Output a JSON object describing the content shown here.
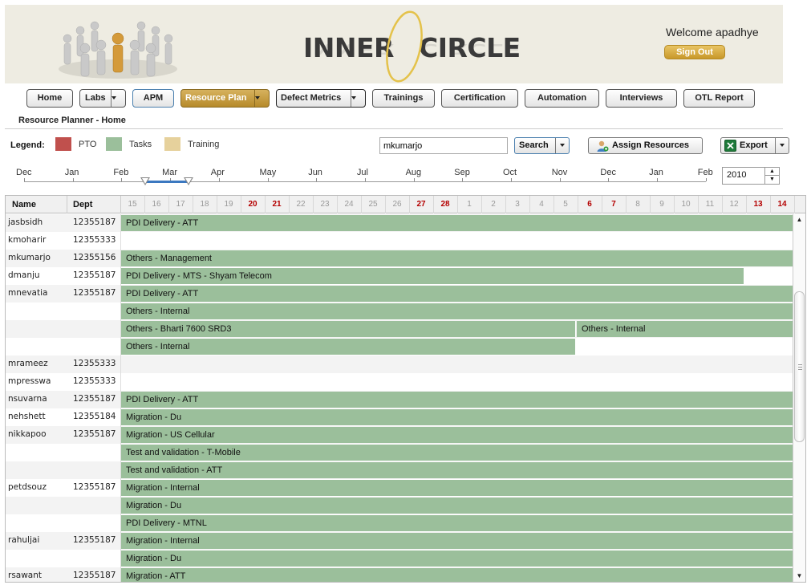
{
  "header": {
    "brand_left": "INNER",
    "brand_right": "CIRCLE",
    "welcome": "Welcome apadhye",
    "signout_label": "Sign Out"
  },
  "nav": [
    {
      "label": "Home"
    },
    {
      "label": "Labs"
    },
    {
      "label": "APM"
    },
    {
      "label": "Resource Plan",
      "active": true
    },
    {
      "label": "Defect Metrics"
    },
    {
      "label": "Trainings"
    },
    {
      "label": "Certification"
    },
    {
      "label": "Automation"
    },
    {
      "label": "Interviews"
    },
    {
      "label": "OTL Report"
    }
  ],
  "breadcrumb": "Resource Planner - Home",
  "legend": {
    "label": "Legend:",
    "items": [
      {
        "label": "PTO",
        "color": "#c0504d"
      },
      {
        "label": "Tasks",
        "color": "#9bbf9b"
      },
      {
        "label": "Training",
        "color": "#e6d19c"
      }
    ]
  },
  "search": {
    "value": "mkumarjo",
    "button_label": "Search"
  },
  "assign_label": "Assign Resources",
  "export_label": "Export",
  "months": [
    "Dec",
    "Jan",
    "Feb",
    "Mar",
    "Apr",
    "May",
    "Jun",
    "Jul",
    "Aug",
    "Sep",
    "Oct",
    "Nov",
    "Dec",
    "Jan",
    "Feb"
  ],
  "year": "2010",
  "grid": {
    "col_name": "Name",
    "col_dept": "Dept",
    "days": [
      "15",
      "16",
      "17",
      "18",
      "19",
      "20",
      "21",
      "22",
      "23",
      "24",
      "25",
      "26",
      "27",
      "28",
      "1",
      "2",
      "3",
      "4",
      "5",
      "6",
      "7",
      "8",
      "9",
      "10",
      "11",
      "12",
      "13",
      "14"
    ],
    "weekend_days": [
      "20",
      "21",
      "27",
      "28",
      "6",
      "7",
      "13",
      "14"
    ],
    "rows": [
      {
        "name": "jasbsidh",
        "dept": "12355187",
        "task": "PDI Delivery - ATT"
      },
      {
        "name": "kmoharir",
        "dept": "12355333",
        "task": ""
      },
      {
        "name": "mkumarjo",
        "dept": "12355156",
        "task": "Others - Management"
      },
      {
        "name": "dmanju",
        "dept": "12355187",
        "task": "PDI Delivery - MTS - Shyam Telecom"
      },
      {
        "name": "mnevatia",
        "dept": "12355187",
        "task": "PDI Delivery - ATT"
      },
      {
        "name": "",
        "dept": "",
        "task": "Others - Internal"
      },
      {
        "name": "",
        "dept": "",
        "task": "Others - Bharti 7600 SRD3",
        "task2": "Others - Internal"
      },
      {
        "name": "",
        "dept": "",
        "task": "Others - Internal"
      },
      {
        "name": "mrameez",
        "dept": "12355333",
        "task": ""
      },
      {
        "name": "mpresswa",
        "dept": "12355333",
        "task": ""
      },
      {
        "name": "nsuvarna",
        "dept": "12355187",
        "task": "PDI Delivery - ATT"
      },
      {
        "name": "nehshett",
        "dept": "12355184",
        "task": "Migration - Du"
      },
      {
        "name": "nikkapoo",
        "dept": "12355187",
        "task": "Migration - US Cellular"
      },
      {
        "name": "",
        "dept": "",
        "task": "Test and validation - T-Mobile"
      },
      {
        "name": "",
        "dept": "",
        "task": "Test and validation - ATT"
      },
      {
        "name": "petdsouz",
        "dept": "12355187",
        "task": "Migration - Internal"
      },
      {
        "name": "",
        "dept": "",
        "task": "Migration - Du"
      },
      {
        "name": "",
        "dept": "",
        "task": "PDI Delivery - MTNL"
      },
      {
        "name": "rahuljai",
        "dept": "12355187",
        "task": "Migration - Internal"
      },
      {
        "name": "",
        "dept": "",
        "task": "Migration - Du"
      },
      {
        "name": "rsawant",
        "dept": "12355187",
        "task": "Migration - ATT"
      }
    ]
  }
}
